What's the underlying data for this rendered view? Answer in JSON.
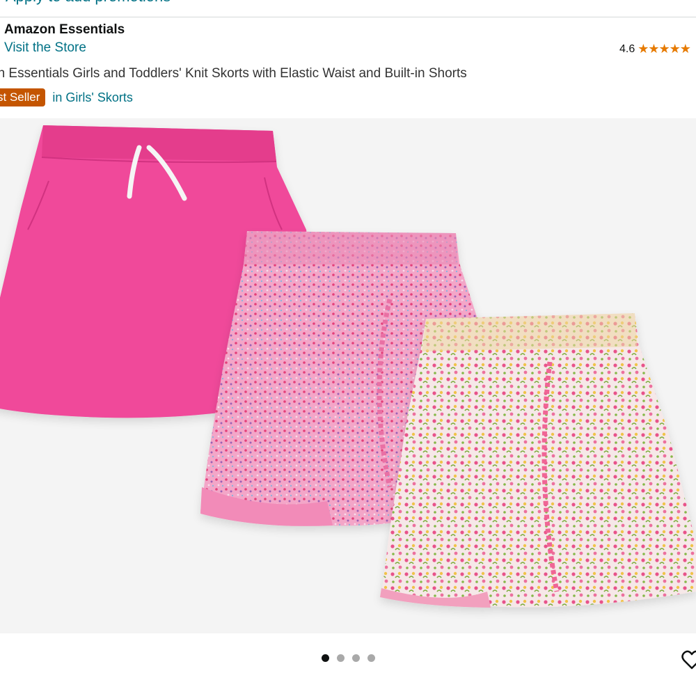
{
  "header": {
    "top_banner_text": "Apply to add promotions"
  },
  "product": {
    "brand": "Amazon Essentials",
    "store_link": "Visit the Store",
    "rating_value": "4.6",
    "rating_stars": "★★★★★",
    "title": "on Essentials Girls and Toddlers' Knit Skorts with Elastic Waist and Built-in Shorts",
    "badge": "st Seller",
    "category_link": "in Girls' Skorts"
  },
  "gallery": {
    "image_count": 4,
    "active_index": 0,
    "items": [
      "pink-skort",
      "floral-pink-skort",
      "floral-multicolor-skort"
    ]
  },
  "colors": {
    "link": "#007185",
    "badge": "#C45500",
    "stars": "#E67A00",
    "skort_pink": "#F0499A"
  },
  "icons": {
    "wishlist": "heart-icon"
  }
}
